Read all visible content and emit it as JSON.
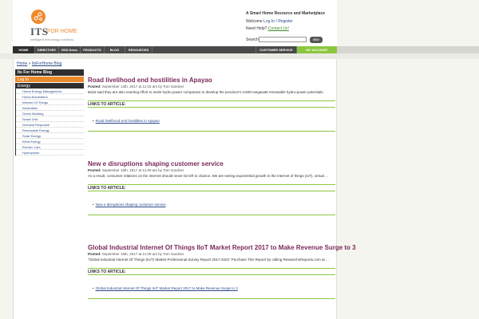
{
  "header": {
    "logo_its": "ITS",
    "logo_forhome": "FOR HOME",
    "logo_tagline": "intelligent technology solutions",
    "tagline": "A Smart Home Resource and Marketplace",
    "welcome_prefix": "Welcome ",
    "login_register": "Log In / Register",
    "help_prefix": "Need Help? ",
    "contact_us": "Contact Us!",
    "search_label": "Search",
    "search_value": "",
    "search_button": "GO!"
  },
  "nav": {
    "items": [
      "HOME",
      "DIRECTORY",
      "RSS News",
      "PRODUCTS",
      "BLOG",
      "RESOURCES"
    ],
    "customer_service": "CUSTOMER SERVICE",
    "my_account": "MY ACCOUNT"
  },
  "breadcrumb": {
    "home": "Home",
    "sep": " » ",
    "current": "ItsForHome Blog"
  },
  "sidebar": {
    "heading": "Its For Home Blog",
    "login": "Log In",
    "category": "Energy",
    "items": [
      "Home Energy Management",
      "Home Automation",
      "Internet Of Things",
      "Wearables",
      "Green Building",
      "Smart Grid",
      "Demand Response",
      "Renewable Energy",
      "Solar Energy",
      "Wind Energy",
      "Electric Cars",
      "Hydropower"
    ]
  },
  "posts": [
    {
      "title": "Road livelihood end hostilities in Apayao",
      "meta_label": "Posted:",
      "meta": " September 14th, 2017 at 11:15 am by Tom Gardner",
      "body": "Bulut said they are also exerting effort to invite hydro power companies to develop the province's 3,500-megawatt renewable hydro-power potentials.",
      "links_heading": "LINKS TO ARTICLE:",
      "link": "Road livelihood end hostilities in Apayao"
    },
    {
      "title": "New e disruptions shaping customer service",
      "meta_label": "Posted:",
      "meta": " September 15th, 2017 at 11:09 am by Tom Gardner",
      "body": "As a result, consumer relations on the internet should never be left to chance. We are seeing exponential growth in the Internet of things (IoT), virtual ...",
      "links_heading": "LINKS TO ARTICLE:",
      "link": "New e disruptions shaping customer service"
    },
    {
      "title": "Global Industrial Internet Of Things IIoT Market Report 2017 to Make Revenue Surge to 3",
      "meta_label": "Posted:",
      "meta": " September 15th, 2017 at 11:09 am by Tom Gardner",
      "body": "“Global Industrial Internet Of Things (IIoT) Market Professional Survey Report 2017-2022” Purchase This Report by calling ResearchnReports.com at ...",
      "links_heading": "LINKS TO ARTICLE:",
      "link": "Global Industrial Internet Of Things IIoT Market Report 2017 to Make Revenue Surge to 3"
    }
  ]
}
